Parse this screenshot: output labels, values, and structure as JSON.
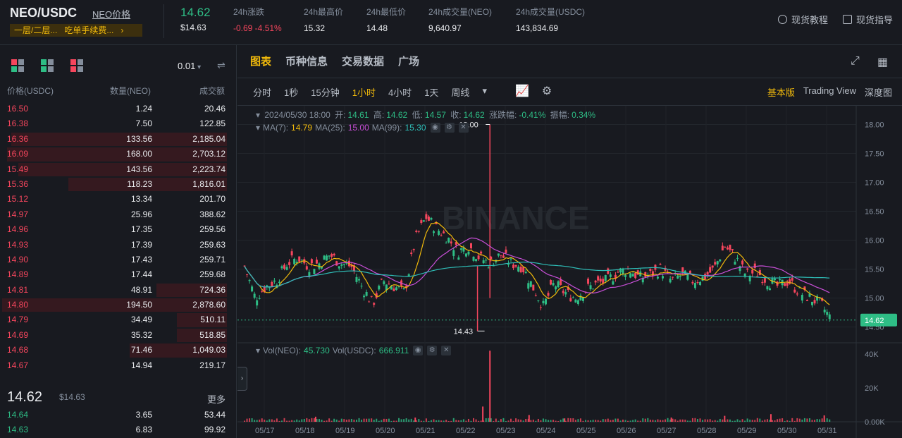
{
  "header": {
    "pair": "NEO/USDC",
    "pair_link": "NEO价格",
    "tags": [
      "一层/二层...",
      "吃单手续费...",
      "›"
    ],
    "last_price": "14.62",
    "last_price_usd": "$14.63",
    "stats": [
      {
        "label": "24h涨跌",
        "value": "-0.69 -4.51%",
        "color": "#f6465d"
      },
      {
        "label": "24h最高价",
        "value": "15.32"
      },
      {
        "label": "24h最低价",
        "value": "14.48"
      },
      {
        "label": "24h成交量(NEO)",
        "value": "9,640.97"
      },
      {
        "label": "24h成交量(USDC)",
        "value": "143,834.69"
      }
    ],
    "links": [
      {
        "label": "现货教程",
        "icon": "play-circle-icon"
      },
      {
        "label": "现货指导",
        "icon": "book-icon"
      }
    ]
  },
  "orderbook": {
    "precision": "0.01",
    "columns": [
      "价格(USDC)",
      "数量(NEO)",
      "成交额"
    ],
    "asks": [
      {
        "price": "16.50",
        "qty": "1.24",
        "total": "20.46",
        "depth": 0
      },
      {
        "price": "16.38",
        "qty": "7.50",
        "total": "122.85",
        "depth": 0
      },
      {
        "price": "16.36",
        "qty": "133.56",
        "total": "2,185.04",
        "depth": 0.95
      },
      {
        "price": "16.09",
        "qty": "168.00",
        "total": "2,703.12",
        "depth": 0.97
      },
      {
        "price": "15.49",
        "qty": "143.56",
        "total": "2,223.74",
        "depth": 0.92
      },
      {
        "price": "15.36",
        "qty": "118.23",
        "total": "1,816.01",
        "depth": 0.7
      },
      {
        "price": "15.12",
        "qty": "13.34",
        "total": "201.70",
        "depth": 0
      },
      {
        "price": "14.97",
        "qty": "25.96",
        "total": "388.62",
        "depth": 0
      },
      {
        "price": "14.96",
        "qty": "17.35",
        "total": "259.56",
        "depth": 0
      },
      {
        "price": "14.93",
        "qty": "17.39",
        "total": "259.63",
        "depth": 0
      },
      {
        "price": "14.90",
        "qty": "17.43",
        "total": "259.71",
        "depth": 0
      },
      {
        "price": "14.89",
        "qty": "17.44",
        "total": "259.68",
        "depth": 0
      },
      {
        "price": "14.81",
        "qty": "48.91",
        "total": "724.36",
        "depth": 0.31
      },
      {
        "price": "14.80",
        "qty": "194.50",
        "total": "2,878.60",
        "depth": 0.99
      },
      {
        "price": "14.79",
        "qty": "34.49",
        "total": "510.11",
        "depth": 0.22
      },
      {
        "price": "14.69",
        "qty": "35.32",
        "total": "518.85",
        "depth": 0.22
      },
      {
        "price": "14.68",
        "qty": "71.46",
        "total": "1,049.03",
        "depth": 0.43
      },
      {
        "price": "14.67",
        "qty": "14.94",
        "total": "219.17",
        "depth": 0
      }
    ],
    "mid_price": "14.62",
    "mid_usd": "$14.63",
    "more": "更多",
    "bids": [
      {
        "price": "14.64",
        "qty": "3.65",
        "total": "53.44",
        "depth": 0
      },
      {
        "price": "14.63",
        "qty": "6.83",
        "total": "99.92",
        "depth": 0
      }
    ]
  },
  "chart_panel": {
    "tabs": [
      "图表",
      "币种信息",
      "交易数据",
      "广场"
    ],
    "active_tab": 0,
    "intervals": [
      "分时",
      "1秒",
      "15分钟",
      "1小时",
      "4小时",
      "1天",
      "周线"
    ],
    "active_interval": 3,
    "views": [
      "基本版",
      "Trading View",
      "深度图"
    ],
    "active_view": 0,
    "watermark": "BINANCE",
    "ohlc_legend": {
      "date": "2024/05/30 18:00",
      "open_label": "开:",
      "open": "14.61",
      "high_label": "高:",
      "high": "14.62",
      "low_label": "低:",
      "low": "14.57",
      "close_label": "收:",
      "close": "14.62",
      "change_label": "涨跌幅:",
      "change": "-0.41%",
      "amp_label": "振幅:",
      "amp": "0.34%"
    },
    "ma_legend": {
      "ma7_label": "MA(7):",
      "ma7": "14.79",
      "ma25_label": "MA(25):",
      "ma25": "15.00",
      "ma99_label": "MA(99):",
      "ma99": "15.30"
    },
    "vol_legend": {
      "neo_label": "Vol(NEO):",
      "neo": "45.730",
      "usdc_label": "Vol(USDC):",
      "usdc": "666.911"
    },
    "colors": {
      "up": "#2ebd85",
      "down": "#f6465d",
      "ma7": "#f0b90b",
      "ma25": "#c94fd8",
      "ma99": "#2ebdb7"
    }
  },
  "chart_data": {
    "type": "candlestick",
    "price_axis": {
      "ticks": [
        "18.00",
        "17.50",
        "17.00",
        "16.50",
        "16.00",
        "15.50",
        "15.00",
        "14.50"
      ],
      "ylim": [
        14.3,
        18.25
      ]
    },
    "volume_axis": {
      "ticks": [
        "40K",
        "20K",
        "0.00K"
      ],
      "ylim": [
        0,
        45000
      ]
    },
    "x_ticks": [
      "05/17",
      "05/18",
      "05/19",
      "05/20",
      "05/21",
      "05/22",
      "05/23",
      "05/24",
      "05/25",
      "05/26",
      "05/27",
      "05/28",
      "05/29",
      "05/30",
      "05/31"
    ],
    "last_price_tag": "14.62",
    "high_marker": "18.00",
    "low_marker": "14.43",
    "close_path": [
      [
        0,
        15.55
      ],
      [
        6,
        15.0
      ],
      [
        12,
        15.2
      ],
      [
        18,
        15.3
      ],
      [
        24,
        15.6
      ],
      [
        30,
        15.7
      ],
      [
        36,
        15.55
      ],
      [
        42,
        15.6
      ],
      [
        48,
        15.75
      ],
      [
        54,
        15.6
      ],
      [
        60,
        15.55
      ],
      [
        66,
        15.2
      ],
      [
        72,
        14.9
      ],
      [
        78,
        15.3
      ],
      [
        84,
        15.2
      ],
      [
        90,
        15.1
      ],
      [
        96,
        16.0
      ],
      [
        102,
        16.4
      ],
      [
        108,
        16.2
      ],
      [
        114,
        16.05
      ],
      [
        120,
        15.8
      ],
      [
        126,
        15.9
      ],
      [
        132,
        15.7
      ],
      [
        138,
        15.6
      ],
      [
        144,
        15.75
      ],
      [
        150,
        15.6
      ],
      [
        156,
        15.55
      ],
      [
        162,
        15.2
      ],
      [
        168,
        14.85
      ],
      [
        174,
        15.25
      ],
      [
        180,
        15.1
      ],
      [
        186,
        15.0
      ],
      [
        192,
        15.15
      ],
      [
        198,
        15.25
      ],
      [
        204,
        15.3
      ],
      [
        210,
        15.45
      ],
      [
        216,
        15.5
      ],
      [
        222,
        15.35
      ],
      [
        228,
        15.4
      ],
      [
        234,
        15.5
      ],
      [
        240,
        15.3
      ],
      [
        246,
        15.4
      ],
      [
        252,
        15.3
      ],
      [
        258,
        15.35
      ],
      [
        264,
        15.5
      ],
      [
        270,
        15.9
      ],
      [
        276,
        15.7
      ],
      [
        282,
        15.4
      ],
      [
        288,
        15.45
      ],
      [
        294,
        15.3
      ],
      [
        300,
        15.2
      ],
      [
        306,
        15.3
      ],
      [
        312,
        15.1
      ],
      [
        318,
        15.0
      ],
      [
        324,
        14.9
      ],
      [
        330,
        14.62
      ]
    ],
    "volume_spikes": [
      {
        "t": 138,
        "vol": 42000
      },
      {
        "t": 134,
        "vol": 9000
      },
      {
        "t": 40,
        "vol": 3000
      },
      {
        "t": 96,
        "vol": 2500
      },
      {
        "t": 160,
        "vol": 4000
      },
      {
        "t": 270,
        "vol": 3500
      },
      {
        "t": 296,
        "vol": 4500
      },
      {
        "t": 326,
        "vol": 3800
      },
      {
        "t": 180,
        "vol": 2000
      },
      {
        "t": 240,
        "vol": 2500
      }
    ]
  }
}
